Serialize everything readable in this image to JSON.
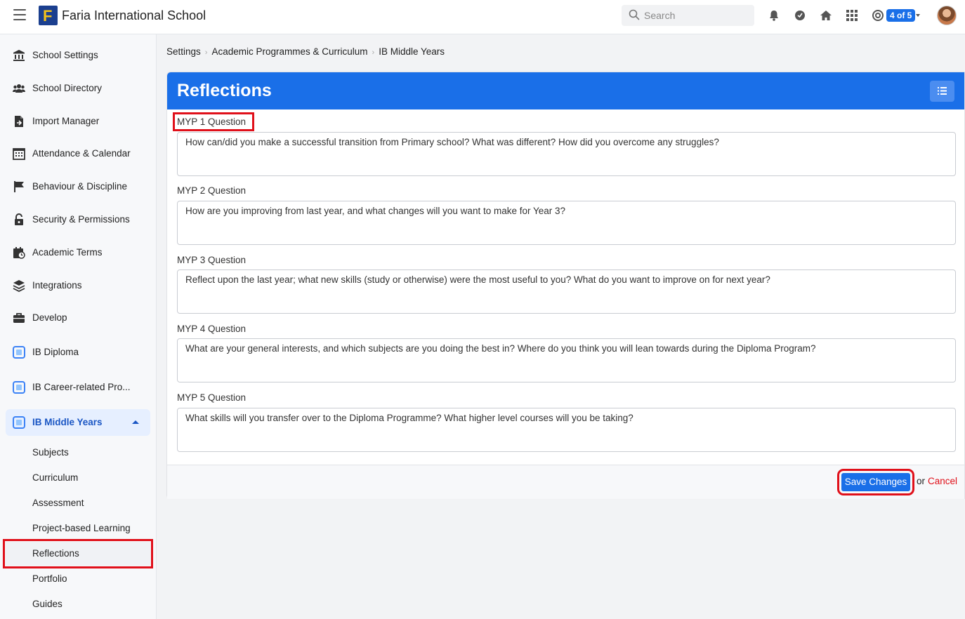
{
  "header": {
    "school_name": "Faria International School",
    "logo_letter": "F",
    "search_placeholder": "Search",
    "school_switch_badge": "4 of 5"
  },
  "sidebar": {
    "items": [
      {
        "label": "School Settings",
        "icon": "bank-icon"
      },
      {
        "label": "School Directory",
        "icon": "users-icon"
      },
      {
        "label": "Import Manager",
        "icon": "file-import-icon"
      },
      {
        "label": "Attendance & Calendar",
        "icon": "calendar-grid-icon"
      },
      {
        "label": "Behaviour & Discipline",
        "icon": "flag-icon"
      },
      {
        "label": "Security & Permissions",
        "icon": "lock-icon"
      },
      {
        "label": "Academic Terms",
        "icon": "calendar-clock-icon"
      },
      {
        "label": "Integrations",
        "icon": "layers-icon"
      },
      {
        "label": "Develop",
        "icon": "briefcase-icon"
      },
      {
        "label": "IB Diploma",
        "icon": "ib-dp-icon"
      },
      {
        "label": "IB Career-related Pro...",
        "icon": "ib-cp-icon"
      },
      {
        "label": "IB Middle Years",
        "icon": "ib-myp-icon"
      }
    ],
    "sub_items": [
      {
        "label": "Subjects"
      },
      {
        "label": "Curriculum"
      },
      {
        "label": "Assessment"
      },
      {
        "label": "Project-based Learning"
      },
      {
        "label": "Reflections"
      },
      {
        "label": "Portfolio"
      },
      {
        "label": "Guides"
      }
    ]
  },
  "breadcrumb": [
    "Settings",
    "Academic Programmes & Curriculum",
    "IB Middle Years"
  ],
  "panel": {
    "title": "Reflections",
    "questions": [
      {
        "label": "MYP 1 Question",
        "value": "How can/did you make a successful transition from Primary school? What was different? How did you overcome any struggles?"
      },
      {
        "label": "MYP 2 Question",
        "value": "How are you improving from last year, and what changes will you want to make for Year 3?"
      },
      {
        "label": "MYP 3 Question",
        "value": "Reflect upon the last year; what new skills (study or otherwise) were the most useful to you? What do you want to improve on for next year?"
      },
      {
        "label": "MYP 4 Question",
        "value": "What are your general interests, and which subjects are you doing the best in? Where do you think you will lean towards during the Diploma Program?"
      },
      {
        "label": "MYP 5 Question",
        "value": "What skills will you transfer over to the Diploma Programme? What higher level courses will you be taking?"
      }
    ],
    "save_label": "Save Changes",
    "or_text": "or",
    "cancel_label": "Cancel"
  },
  "colors": {
    "accent": "#1a6fe8",
    "highlight": "#e0101a",
    "cancel": "#e0101a"
  }
}
